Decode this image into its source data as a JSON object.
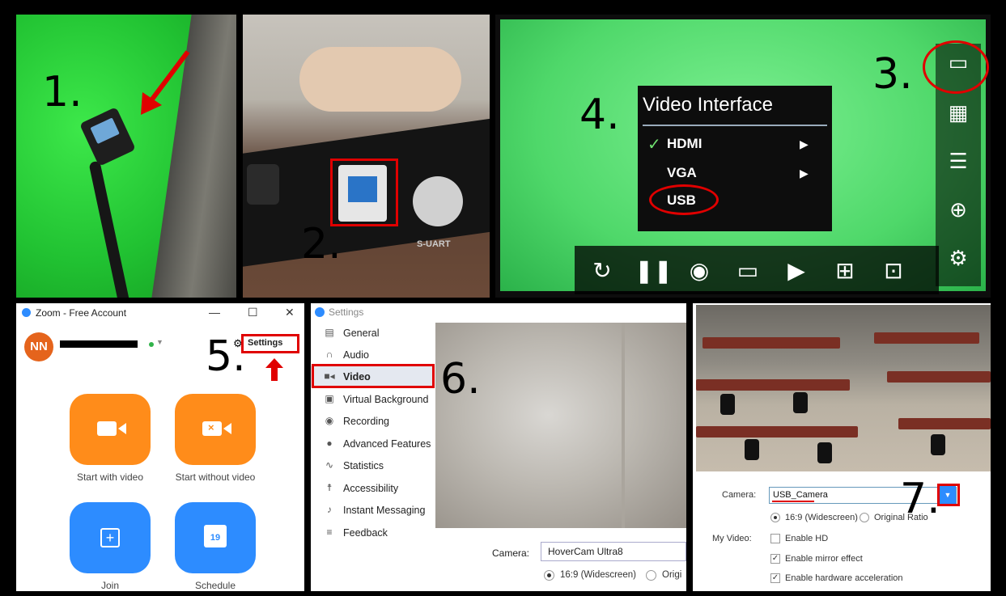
{
  "steps": {
    "s1": "1.",
    "s2": "2.",
    "s3": "3.",
    "s4": "4.",
    "s5": "5.",
    "s6": "6.",
    "s7": "7."
  },
  "panel2": {
    "port_label": "S-UART"
  },
  "panel3": {
    "menu_title": "Video Interface",
    "items": [
      {
        "label": "HDMI",
        "checked": true,
        "has_submenu": true
      },
      {
        "label": "VGA",
        "checked": false,
        "has_submenu": true
      },
      {
        "label": "USB",
        "checked": false,
        "has_submenu": false
      }
    ],
    "side_icons": [
      "monitor-icon",
      "grid-icon",
      "sliders-icon",
      "zoom-in-icon",
      "gear-icon"
    ],
    "bottom_icons": [
      "rotate-icon",
      "pause-icon",
      "camera-icon",
      "video-icon",
      "play-icon",
      "crosshair-icon",
      "lock-crosshair-icon"
    ]
  },
  "zoom": {
    "title": "Zoom - Free Account",
    "avatar_initials": "NN",
    "settings_label": "Settings",
    "buttons": [
      {
        "label": "Start with video",
        "color": "#ff8c1a"
      },
      {
        "label": "Start without video",
        "color": "#ff8c1a"
      },
      {
        "label": "Join",
        "color": "#2d8cff"
      },
      {
        "label": "Schedule",
        "color": "#2d8cff"
      }
    ],
    "calendar_day": "19"
  },
  "settings": {
    "title": "Settings",
    "nav": [
      {
        "label": "General",
        "icon": "gear-icon"
      },
      {
        "label": "Audio",
        "icon": "headphones-icon"
      },
      {
        "label": "Video",
        "icon": "video-icon",
        "active": true
      },
      {
        "label": "Virtual Background",
        "icon": "image-icon"
      },
      {
        "label": "Recording",
        "icon": "record-icon"
      },
      {
        "label": "Advanced Features",
        "icon": "person-icon"
      },
      {
        "label": "Statistics",
        "icon": "pulse-icon"
      },
      {
        "label": "Accessibility",
        "icon": "accessibility-icon"
      },
      {
        "label": "Instant Messaging",
        "icon": "bell-icon"
      },
      {
        "label": "Feedback",
        "icon": "feedback-icon"
      }
    ],
    "camera_label": "Camera:",
    "camera_value": "HoverCam Ultra8",
    "ratio_widescreen": "16:9 (Widescreen)",
    "ratio_original": "Origi"
  },
  "video_settings": {
    "camera_label": "Camera:",
    "camera_value": "USB_Camera",
    "ratio_widescreen": "16:9 (Widescreen)",
    "ratio_original": "Original Ratio",
    "my_video_label": "My Video:",
    "options": [
      {
        "label": "Enable HD",
        "checked": false
      },
      {
        "label": "Enable mirror effect",
        "checked": true
      },
      {
        "label": "Enable hardware acceleration",
        "checked": true
      }
    ]
  },
  "colors": {
    "highlight": "#e00000",
    "zoom_blue": "#2d8cff",
    "zoom_orange": "#ff8c1a"
  }
}
